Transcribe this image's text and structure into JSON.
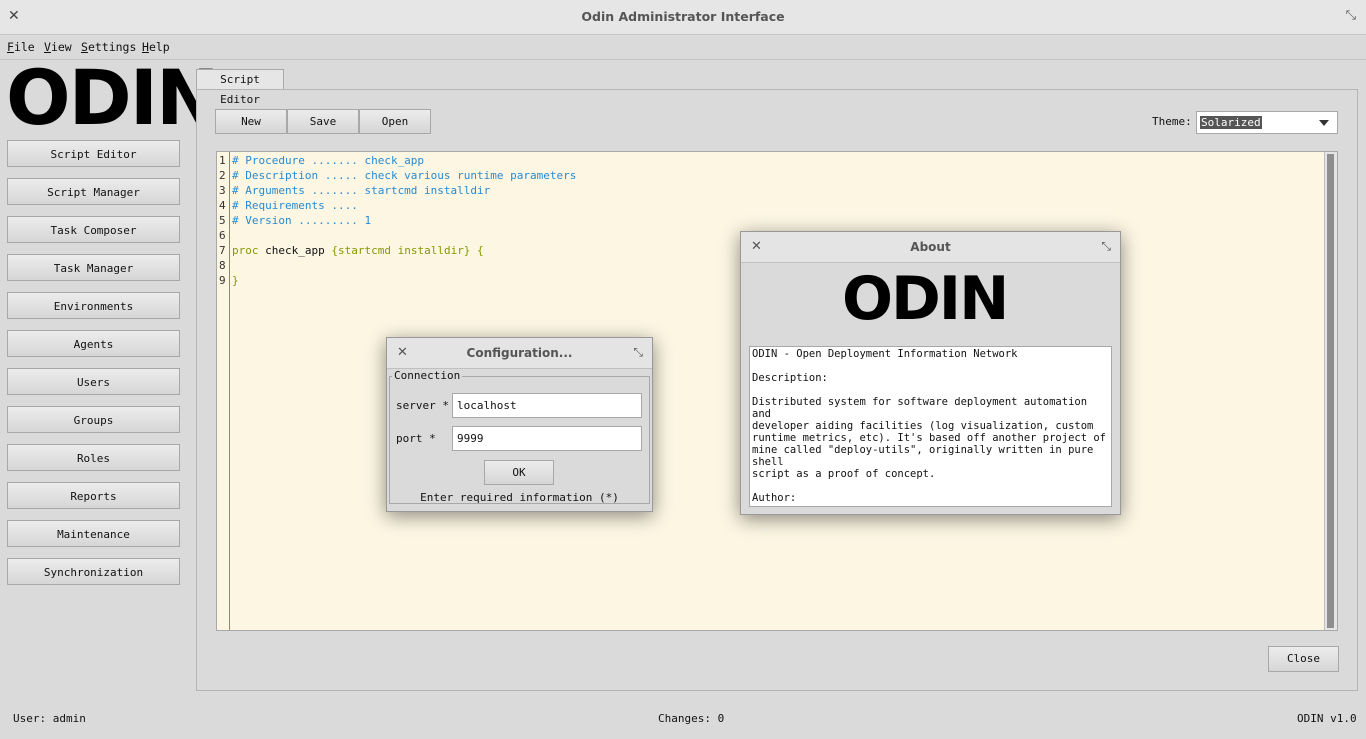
{
  "window": {
    "title": "Odin Administrator Interface"
  },
  "menu": {
    "file": "File",
    "view": "View",
    "settings": "Settings",
    "help": "Help"
  },
  "logo_text": "ODIN",
  "sidebar": {
    "items": [
      "Script Editor",
      "Script Manager",
      "Task Composer",
      "Task Manager",
      "Environments",
      "Agents",
      "Users",
      "Groups",
      "Roles",
      "Reports",
      "Maintenance",
      "Synchronization"
    ]
  },
  "tab": {
    "label": "Script Editor"
  },
  "toolbar": {
    "new": "New",
    "save": "Save",
    "open": "Open",
    "theme_label": "Theme:",
    "theme_value": "Solarized"
  },
  "editor": {
    "line_numbers": [
      "1",
      "2",
      "3",
      "4",
      "5",
      "6",
      "7",
      "8",
      "9"
    ],
    "lines": [
      "# Procedure ....... check_app",
      "# Description ..... check various runtime parameters",
      "# Arguments ....... startcmd installdir",
      "# Requirements ....",
      "# Version ......... 1",
      "",
      "proc check_app {startcmd installdir} {",
      "",
      "}"
    ],
    "line7": {
      "kw": "proc",
      "name": " check_app ",
      "args": "{startcmd installdir} {"
    }
  },
  "close_button": "Close",
  "config_dialog": {
    "title": "Configuration...",
    "group": "Connection",
    "server_label": "server *",
    "server_value": "localhost",
    "port_label": "port *",
    "port_value": "9999",
    "ok": "OK",
    "hint": "Enter required information (*)"
  },
  "about_dialog": {
    "title": "About",
    "text": "ODIN - Open Deployment Information Network\n\nDescription:\n\nDistributed system for software deployment automation and\ndeveloper aiding facilities (log visualization, custom\nruntime metrics, etc). It's based off another project of\nmine called \"deploy-utils\", originally written in pure shell\nscript as a proof of concept.\n\nAuthor:\n\nGabriel Aires Guedes - airesgabriel@gmail.com"
  },
  "status": {
    "user": "User: admin",
    "changes": "Changes: 0",
    "version": "ODIN v1.0"
  },
  "colors": {
    "editor_bg": "#fdf6e3",
    "comment": "#268bd2",
    "keyword": "#859900"
  }
}
